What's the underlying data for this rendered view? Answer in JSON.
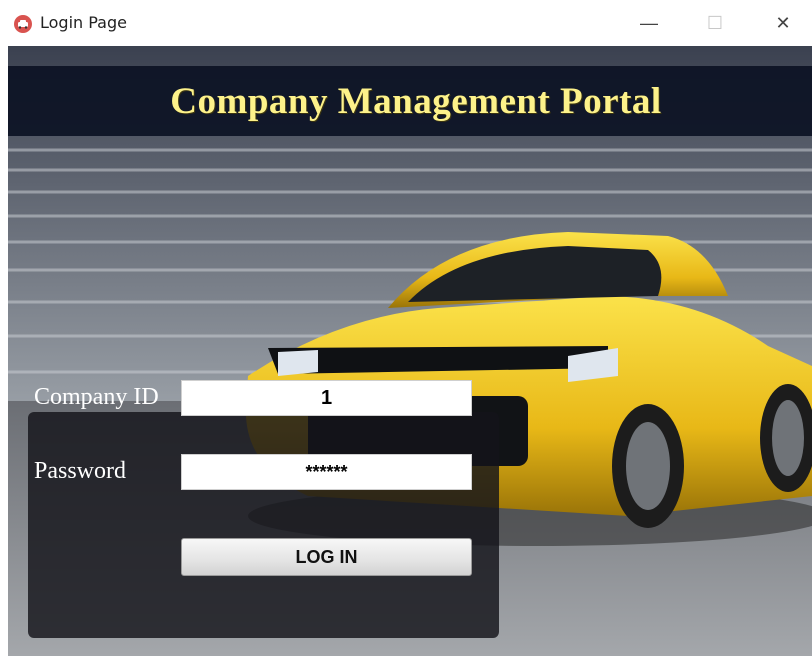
{
  "window": {
    "title": "Login Page",
    "app_icon": "car-icon",
    "controls": {
      "minimize": "—",
      "maximize": "☐",
      "close": "✕"
    }
  },
  "header": {
    "title": "Company Management Portal"
  },
  "login_form": {
    "company_id_label": "Company ID",
    "company_id_value": "1",
    "password_label": "Password",
    "password_value": "******",
    "login_button": "LOG IN"
  },
  "colors": {
    "title_text": "#fdf28a",
    "header_band": "#0c1224",
    "car_body": "#f0c81c",
    "panel_bg": "#14141a"
  }
}
